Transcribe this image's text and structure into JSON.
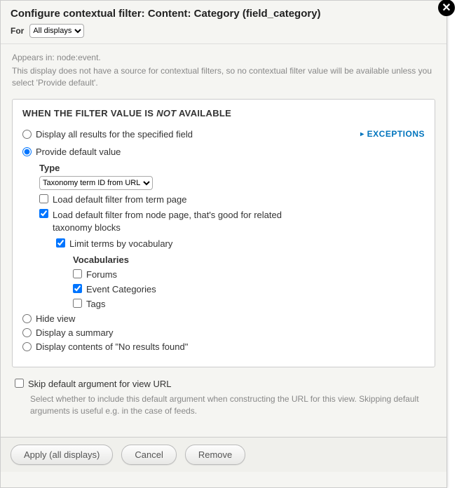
{
  "header": {
    "title": "Configure contextual filter: Content: Category (field_category)",
    "for_label": "For",
    "for_select": "All displays"
  },
  "appears_in": "Appears in: node:event.",
  "description": "This display does not have a source for contextual filters, so no contextual filter value will be available unless you select 'Provide default'.",
  "fieldset": {
    "title_pre": "WHEN THE FILTER VALUE IS ",
    "title_em": "NOT",
    "title_post": " AVAILABLE",
    "exceptions": "EXCEPTIONS",
    "radios": {
      "display_all": "Display all results for the specified field",
      "provide_default": "Provide default value",
      "hide_view": "Hide view",
      "display_summary": "Display a summary",
      "no_results": "Display contents of \"No results found\""
    },
    "type_label": "Type",
    "type_value": "Taxonomy term ID from URL",
    "cb_load_term": "Load default filter from term page",
    "cb_load_node": "Load default filter from node page, that's good for related taxonomy blocks",
    "cb_limit_vocab": "Limit terms by vocabulary",
    "vocab_label": "Vocabularies",
    "vocabs": [
      "Forums",
      "Event Categories",
      "Tags"
    ]
  },
  "skip": {
    "label": "Skip default argument for view URL",
    "desc": "Select whether to include this default argument when constructing the URL for this view. Skipping default arguments is useful e.g. in the case of feeds."
  },
  "buttons": {
    "apply": "Apply (all displays)",
    "cancel": "Cancel",
    "remove": "Remove"
  }
}
